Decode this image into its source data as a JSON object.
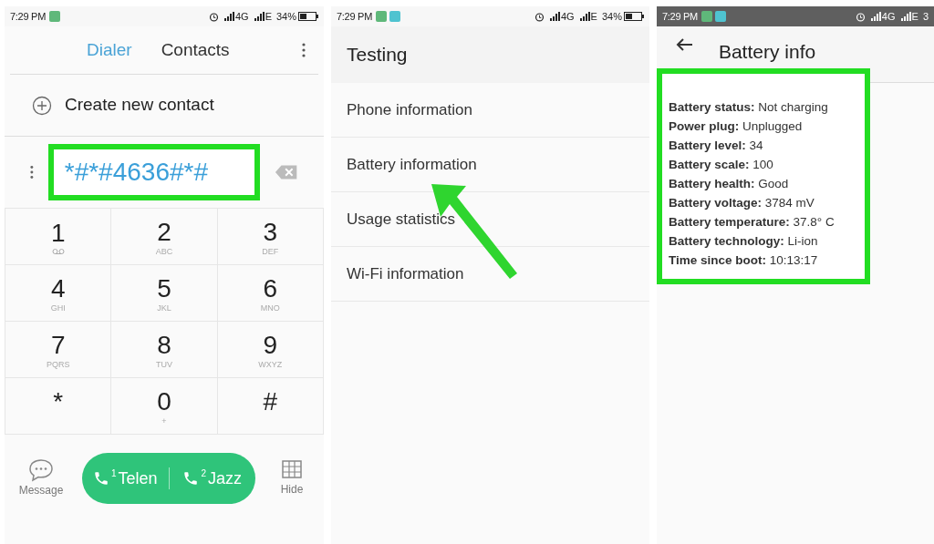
{
  "panels": [
    {
      "kind": "dialer",
      "status": {
        "time": "7:29 PM",
        "net1": "4G",
        "net2": "E",
        "battery": "34%"
      },
      "tabs": [
        {
          "label": "Dialer",
          "selected": true
        },
        {
          "label": "Contacts",
          "selected": false
        }
      ],
      "create_contact": "Create new contact",
      "dialed": "*#*#4636#*#",
      "keys": [
        {
          "digit": "1"
        },
        {
          "digit": "2",
          "letters": "ABC"
        },
        {
          "digit": "3",
          "letters": "DEF"
        },
        {
          "digit": "4",
          "letters": "GHI"
        },
        {
          "digit": "5",
          "letters": "JKL"
        },
        {
          "digit": "6",
          "letters": "MNO"
        },
        {
          "digit": "7",
          "letters": "PQRS"
        },
        {
          "digit": "8",
          "letters": "TUV"
        },
        {
          "digit": "9",
          "letters": "WXYZ"
        },
        {
          "digit": "*"
        },
        {
          "digit": "0",
          "letters": "+"
        },
        {
          "digit": "#"
        }
      ],
      "message": "Message",
      "sims": [
        {
          "slot": "1",
          "name": "Telen"
        },
        {
          "slot": "2",
          "name": "Jazz"
        }
      ],
      "hide": "Hide"
    },
    {
      "kind": "menu",
      "status": {
        "time": "7:29 PM",
        "net1": "4G",
        "net2": "E",
        "battery": "34%"
      },
      "title": "Testing",
      "items": [
        "Phone information",
        "Battery information",
        "Usage statistics",
        "Wi-Fi information"
      ]
    },
    {
      "kind": "info",
      "status": {
        "time": "7:29 PM",
        "net1": "4G",
        "net2": "E",
        "battery": "3"
      },
      "title": "Battery info",
      "lines": [
        "**Battery status:** Not charging",
        "**Power plug:** Unplugged",
        "**Battery level:** 34",
        "**Battery scale:** 100",
        "**Battery health:** Good",
        "**Battery voltage:** 3784 mV",
        "**Battery temperature:** 37.8° C",
        "**Battery technology:** Li-ion",
        "**Time since boot:** 10:13:17"
      ]
    }
  ]
}
